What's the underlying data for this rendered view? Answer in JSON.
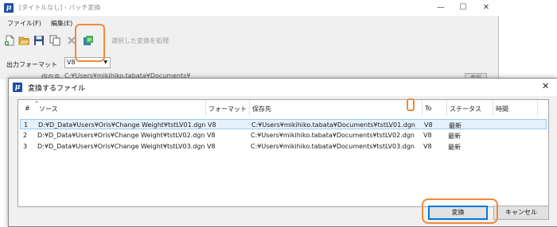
{
  "main_window": {
    "title": "[タイトルなし] - バッチ変換",
    "app_icon_letter": "μ",
    "controls": {
      "minimize": "—",
      "maximize": "☐",
      "close": "✕"
    },
    "menu": [
      {
        "label": "ファイル(F)"
      },
      {
        "label": "編集(E)"
      }
    ],
    "toolbar": {
      "icons": [
        "new-file-icon",
        "open-folder-icon",
        "save-icon",
        "copy-icon",
        "delete-icon",
        "process-selected-icon"
      ],
      "process_label": "選択した変換を処理"
    },
    "output_format": {
      "label": "出力フォーマット",
      "value": "V8"
    },
    "save_location": {
      "label": "保存先",
      "value": "C:¥Users¥mikihiko.tabata¥Documents¥",
      "browse_label": "参照"
    }
  },
  "dialog": {
    "title": "変換するファイル",
    "close": "✕",
    "columns": [
      "#",
      "ソース",
      "フォーマット",
      "保存先",
      "To",
      "ステータス",
      "時間"
    ],
    "rows": [
      {
        "num": "1",
        "source": "D:¥D_Data¥Users¥Oris¥Change Weight¥tstLV01.dgn",
        "format": "V8",
        "dest": "C:¥Users¥mikihiko.tabata¥Documents¥tstLV01.dgn",
        "to": "V8",
        "status": "最新",
        "time": ""
      },
      {
        "num": "2",
        "source": "D:¥D_Data¥Users¥Oris¥Change Weight¥tstLV02.dgn",
        "format": "V8",
        "dest": "C:¥Users¥mikihiko.tabata¥Documents¥tstLV02.dgn",
        "to": "V8",
        "status": "最新",
        "time": ""
      },
      {
        "num": "3",
        "source": "D:¥D_Data¥Users¥Oris¥Change Weight¥tstLV03.dgn",
        "format": "V8",
        "dest": "C:¥Users¥mikihiko.tabata¥Documents¥tstLV03.dgn",
        "to": "V8",
        "status": "最新",
        "time": ""
      }
    ],
    "buttons": {
      "convert": "変換",
      "cancel": "キャンセル"
    }
  },
  "colors": {
    "highlight": "#f08a3c",
    "selection": "#e5f1fb",
    "accent": "#0078d7",
    "app_icon": "#1f4fa5"
  }
}
